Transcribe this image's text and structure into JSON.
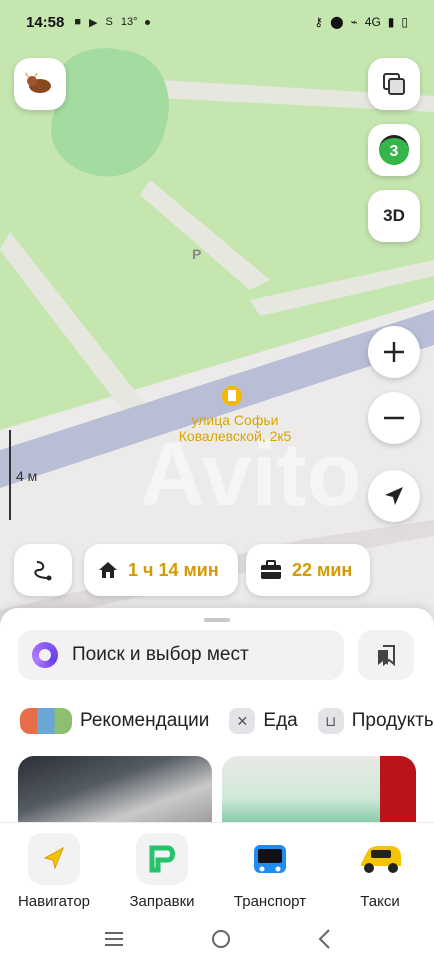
{
  "status": {
    "time": "14:58",
    "temp": "13°",
    "network": "4G"
  },
  "map": {
    "poi_label": "улица Софьи\nКовалевской, 2к5",
    "parking": "P",
    "scale": "4 м",
    "watermark": "Avito",
    "layers_count": "3",
    "btn_3d": "3D"
  },
  "chips": {
    "home_time": "1 ч 14 мин",
    "work_time": "22 мин"
  },
  "search": {
    "placeholder": "Поиск и выбор мест"
  },
  "categories": [
    {
      "label": "Рекомендации"
    },
    {
      "label": "Еда"
    },
    {
      "label": "Продукты"
    }
  ],
  "nav": [
    {
      "label": "Навигатор"
    },
    {
      "label": "Заправки"
    },
    {
      "label": "Транспорт"
    },
    {
      "label": "Такси"
    }
  ],
  "colors": {
    "accent": "#d49a00",
    "park": "#bfe3a8",
    "road": "#b9bfd6"
  }
}
